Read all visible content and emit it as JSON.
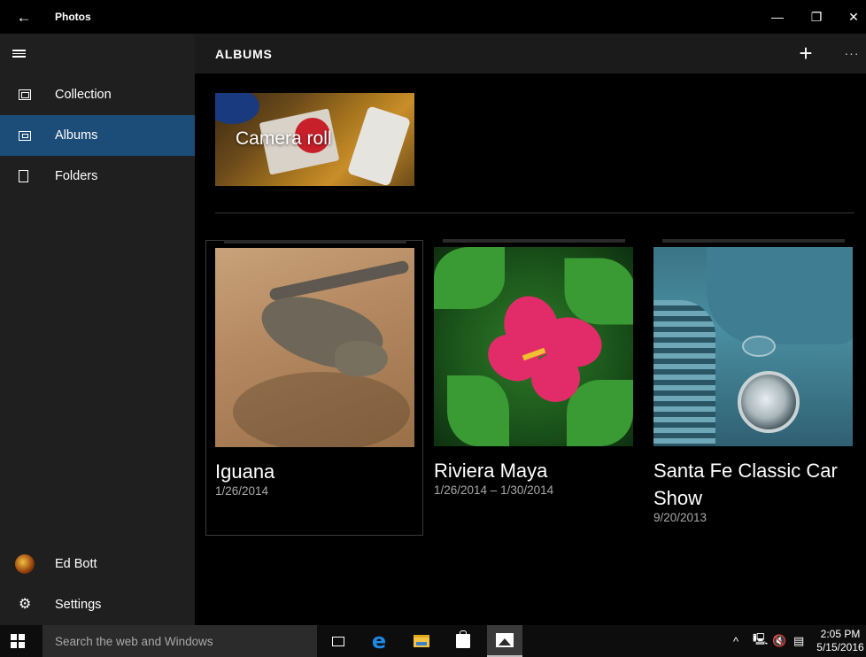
{
  "window": {
    "title": "Photos",
    "back_glyph": "←",
    "minimize_glyph": "—",
    "maximize_glyph": "❐",
    "close_glyph": "✕"
  },
  "sidebar": {
    "items": [
      {
        "label": "Collection",
        "icon": "collection-icon"
      },
      {
        "label": "Albums",
        "icon": "albums-icon",
        "active": true
      },
      {
        "label": "Folders",
        "icon": "folders-icon"
      }
    ],
    "account_name": "Ed Bott",
    "settings_label": "Settings"
  },
  "header": {
    "title": "ALBUMS",
    "add_glyph": "+",
    "more_glyph": "···"
  },
  "camera_roll": {
    "label": "Camera roll"
  },
  "albums": [
    {
      "name": "Iguana",
      "date": "1/26/2014"
    },
    {
      "name": "Riviera Maya",
      "date": "1/26/2014 – 1/30/2014"
    },
    {
      "name": "Santa Fe Classic Car Show",
      "date": "9/20/2013"
    }
  ],
  "taskbar": {
    "search_placeholder": "Search the web and Windows",
    "tray_chevron": "^",
    "time": "2:05 PM",
    "date": "5/15/2016"
  },
  "colors": {
    "accent": "#1c4d79",
    "sidebar_bg": "#1f1f1f",
    "content_bg": "#000000"
  }
}
